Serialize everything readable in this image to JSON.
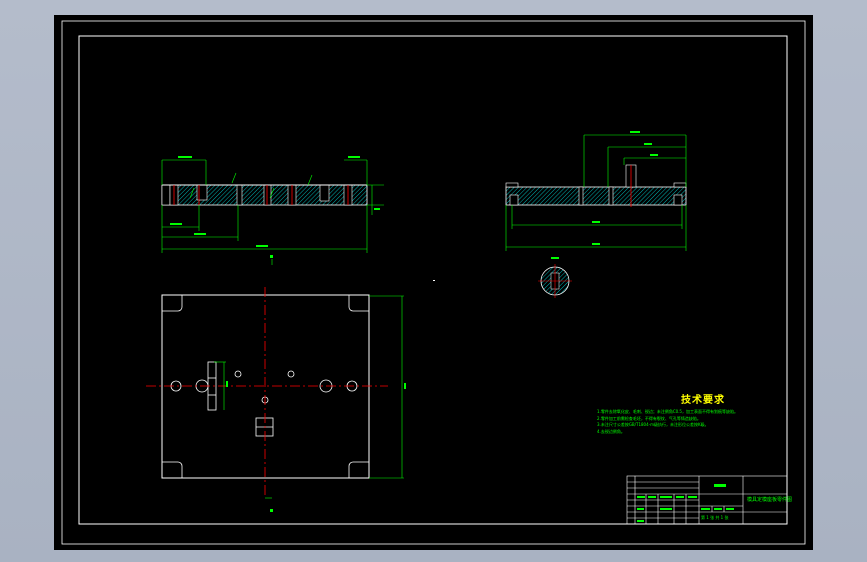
{
  "colors": {
    "background": "#b4bccb",
    "sheet": "#000000",
    "outline": "#ffffff",
    "dimension": "#00ff00",
    "centerline": "#ff0000",
    "hatch": "#00ffff",
    "heading": "#ffff00"
  },
  "tech_requirements": {
    "title": "技术要求",
    "lines": [
      "1.零件去除氧化皮、毛刺、锐边；未注倒角C0.5，加工表面不得有划痕等缺陷。",
      "2.零件加工前需检查毛坯，不得有裂纹、气孔等铸造缺陷。",
      "3.未注尺寸公差按GB/T1804-m级执行，未注形位公差按K级。",
      "4.去锐边倒角。"
    ]
  },
  "title_block": {
    "drawing_title": "模具定模座板零件图",
    "sheet_info": "第 1 张  共 1 张"
  }
}
